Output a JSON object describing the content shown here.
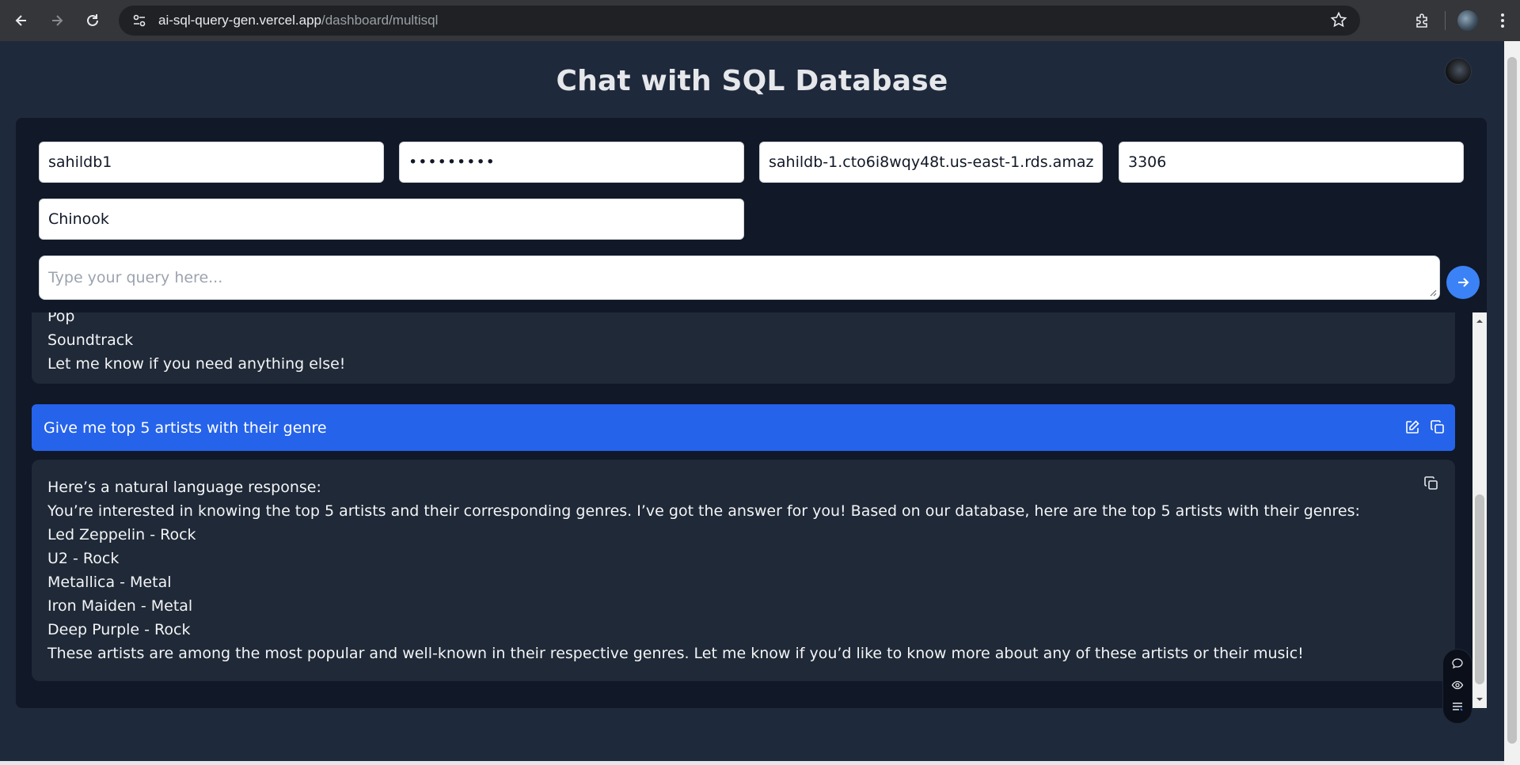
{
  "browser": {
    "url_host": "ai-sql-query-gen.vercel.app",
    "url_path": "/dashboard/multisql"
  },
  "header": {
    "title": "Chat with SQL Database"
  },
  "connection": {
    "username": "sahildb1",
    "password_masked": "•••••••••",
    "host": "sahildb-1.cto6i8wqy48t.us-east-1.rds.amaz",
    "port": "3306",
    "database": "Chinook"
  },
  "query": {
    "placeholder": "Type your query here..."
  },
  "chat": {
    "previous_answer_tail": [
      "Pop",
      "Soundtrack",
      "Let me know if you need anything else!"
    ],
    "user_message": "Give me top 5 artists with their genre",
    "answer_lines": [
      "Here’s a natural language response:",
      "You’re interested in knowing the top 5 artists and their corresponding genres. I’ve got the answer for you! Based on our database, here are the top 5 artists with their genres:",
      "Led Zeppelin - Rock",
      "U2 - Rock",
      "Metallica - Metal",
      "Iron Maiden - Metal",
      "Deep Purple - Rock",
      "These artists are among the most popular and well-known in their respective genres. Let me know if you’d like to know more about any of these artists or their music!"
    ]
  },
  "icons": {
    "back": "back-arrow-icon",
    "forward": "forward-arrow-icon",
    "reload": "reload-icon",
    "site_info": "site-info-icon",
    "bookmark": "star-icon",
    "extensions": "puzzle-icon",
    "menu": "kebab-menu-icon",
    "send": "arrow-right-icon",
    "edit": "edit-icon",
    "copy": "copy-icon"
  },
  "colors": {
    "accent": "#2563eb",
    "send_button": "#3b82f6",
    "panel": "#111827",
    "page_bg": "#1e293b"
  }
}
